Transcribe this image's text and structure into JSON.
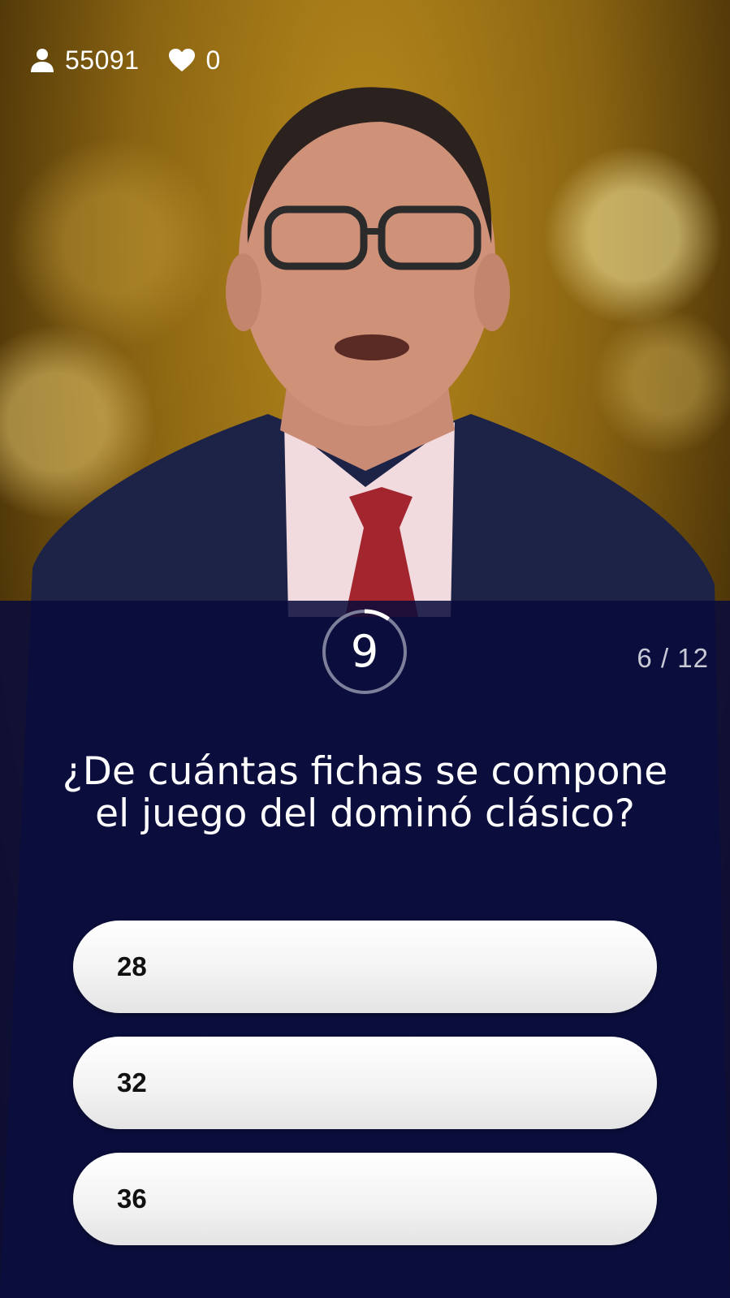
{
  "stats": {
    "viewers_icon": "user-icon",
    "viewers": "55091",
    "lives_icon": "heart-icon",
    "lives": "0"
  },
  "timer": {
    "seconds": "9",
    "remaining_fraction": 0.9
  },
  "progress": "6 / 12",
  "question": "¿De cuántas fichas se compone el juego del dominó clásico?",
  "answers": [
    {
      "label": "28"
    },
    {
      "label": "32"
    },
    {
      "label": "36"
    }
  ],
  "colors": {
    "panel": "#080a3a",
    "answer_bg": "#f5f5f5",
    "answer_text": "#111111",
    "progress_text": "#c9cad6"
  }
}
